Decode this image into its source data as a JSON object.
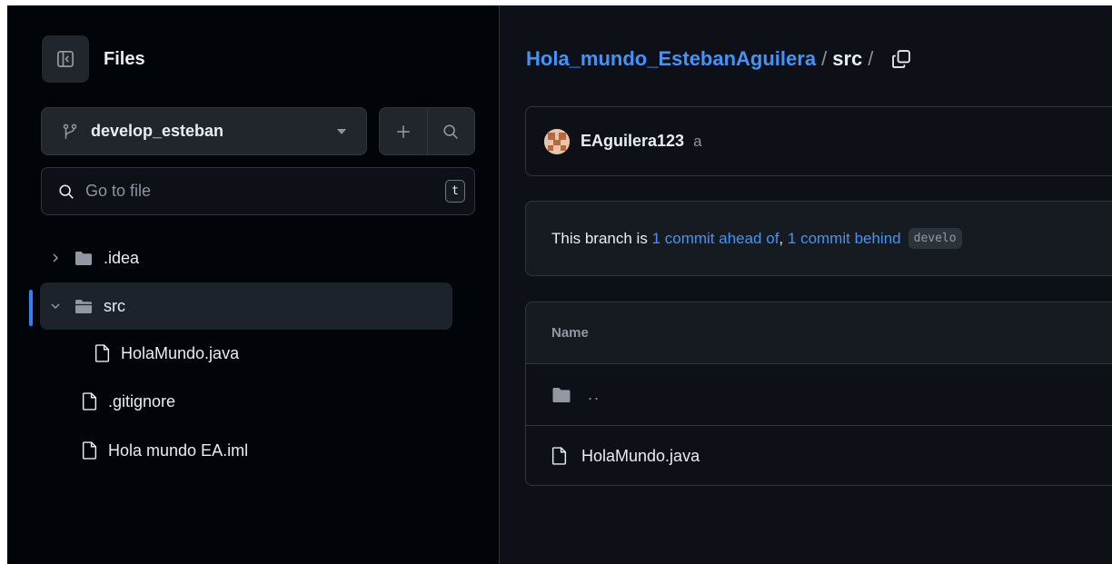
{
  "sidebar": {
    "title": "Files",
    "branch": "develop_esteban",
    "search_placeholder": "Go to file",
    "search_shortcut": "t",
    "tree": [
      {
        "label": ".idea",
        "type": "folder",
        "expanded": false
      },
      {
        "label": "src",
        "type": "folder",
        "expanded": true,
        "selected": true
      },
      {
        "label": "HolaMundo.java",
        "type": "file"
      },
      {
        "label": ".gitignore",
        "type": "file"
      },
      {
        "label": "Hola mundo EA.iml",
        "type": "file"
      }
    ]
  },
  "breadcrumb": {
    "repo": "Hola_mundo_EstebanAguilera",
    "separator": "/",
    "dir": "src",
    "trailing": "/"
  },
  "commit": {
    "author": "EAguilera123",
    "message": "a"
  },
  "branch_status": {
    "prefix": "This branch is",
    "ahead": "1 commit ahead of",
    "comma": ",",
    "behind": "1 commit behind",
    "base": "develo"
  },
  "file_table": {
    "header": "Name",
    "rows": [
      {
        "label": "..",
        "type": "parent-folder"
      },
      {
        "label": "HolaMundo.java",
        "type": "file"
      }
    ]
  },
  "colors": {
    "accent": "#f78166",
    "link": "#4493f8",
    "selection": "#2f81f7"
  }
}
